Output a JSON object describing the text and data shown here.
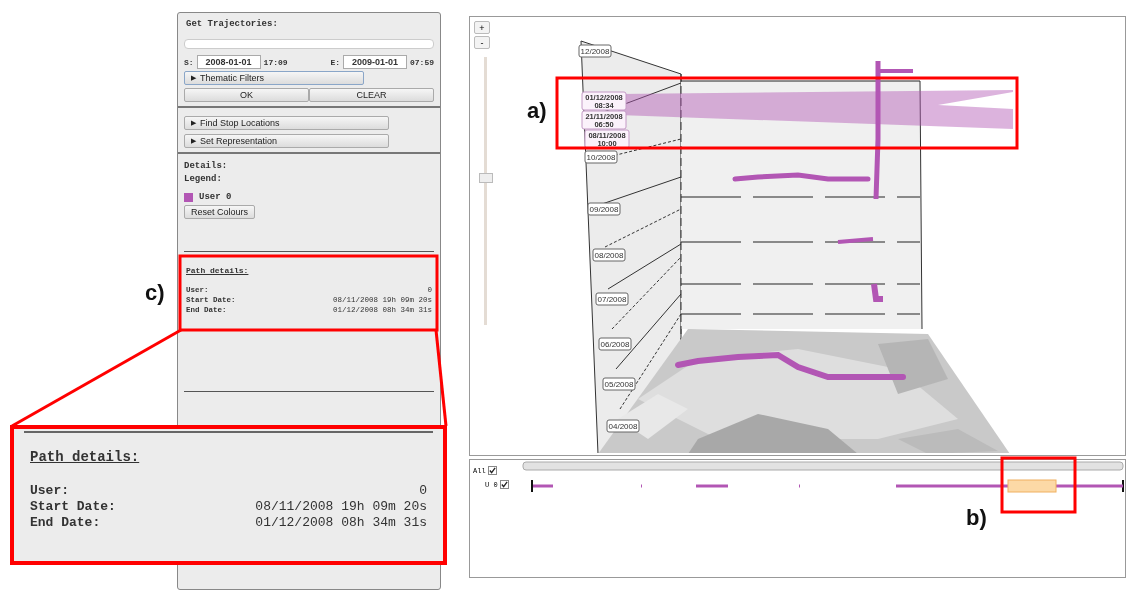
{
  "left_panel": {
    "title": "Get Trajectories:",
    "start": {
      "label": "S:",
      "date": "2008-01-01",
      "time": "17:09"
    },
    "end": {
      "label": "E:",
      "date": "2009-01-01",
      "time": "07:59"
    },
    "filter_button": {
      "icon": "▶",
      "label": "Thematic Filters"
    },
    "actions": [
      "OK",
      "CLEAR"
    ],
    "sections": [
      {
        "icon": "▶",
        "label": "Find Stop Locations"
      },
      {
        "icon": "▶",
        "label": "Set Representation"
      }
    ],
    "details_title": "Details:",
    "legend_title": "Legend:",
    "legend": [
      {
        "label": "User 0",
        "color": "#b256b4"
      }
    ],
    "reset_button": "Reset Colours",
    "path_details": {
      "title": "Path details:",
      "rows": [
        {
          "label": "User:",
          "value": "0"
        },
        {
          "label": "Start Date:",
          "value": "08/11/2008 19h 09m 20s"
        },
        {
          "label": "End Date:",
          "value": "01/12/2008 08h 34m 31s"
        }
      ]
    }
  },
  "cube_view": {
    "zoom_in": "+",
    "zoom_out": "-",
    "zoom_slider": {
      "level": 0.55
    },
    "month_labels": [
      "12/2008",
      "10/2008",
      "09/2008",
      "08/2008",
      "07/2008",
      "06/2008",
      "05/2008",
      "04/2008"
    ],
    "selection_labels": [
      {
        "date": "01/12/2008",
        "time": "08:34"
      },
      {
        "date": "21/11/2008",
        "time": "06:50"
      },
      {
        "date": "08/11/2008",
        "time": "10:00"
      }
    ]
  },
  "timeline": {
    "rows": [
      {
        "label": "All",
        "checked": true
      },
      {
        "label": "U 0",
        "checked": true
      }
    ]
  },
  "annotations": {
    "labels": [
      "a)",
      "b)",
      "c)"
    ],
    "callout": {
      "title": "Path details:",
      "rows": [
        {
          "label": "User:",
          "value": "0"
        },
        {
          "label": "Start Date:",
          "value": "08/11/2008 19h 09m 20s"
        },
        {
          "label": "End Date:",
          "value": "01/12/2008 08h 34m 31s"
        }
      ]
    }
  }
}
